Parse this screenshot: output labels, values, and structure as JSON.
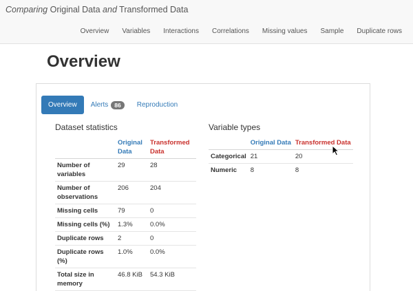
{
  "header": {
    "title_part1": "Comparing",
    "title_part2": " Original Data ",
    "title_part3": "and",
    "title_part4": " Transformed Data",
    "nav": [
      "Overview",
      "Variables",
      "Interactions",
      "Correlations",
      "Missing values",
      "Sample",
      "Duplicate rows"
    ]
  },
  "page_title": "Overview",
  "tabs": {
    "overview": "Overview",
    "alerts": "Alerts",
    "alerts_count": "86",
    "reproduction": "Reproduction"
  },
  "dataset_statistics": {
    "title": "Dataset statistics",
    "col_original": "Original Data",
    "col_transformed": "Transformed Data",
    "rows": [
      {
        "label": "Number of variables",
        "original": "29",
        "transformed": "28"
      },
      {
        "label": "Number of observations",
        "original": "206",
        "transformed": "204"
      },
      {
        "label": "Missing cells",
        "original": "79",
        "transformed": "0"
      },
      {
        "label": "Missing cells (%)",
        "original": "1.3%",
        "transformed": "0.0%"
      },
      {
        "label": "Duplicate rows",
        "original": "2",
        "transformed": "0"
      },
      {
        "label": "Duplicate rows (%)",
        "original": "1.0%",
        "transformed": "0.0%"
      },
      {
        "label": "Total size in memory",
        "original": "46.8 KiB",
        "transformed": "54.3 KiB"
      }
    ]
  },
  "variable_types": {
    "title": "Variable types",
    "col_original": "Original Data",
    "col_transformed": "Transformed Data",
    "rows": [
      {
        "label": "Categorical",
        "original": "21",
        "transformed": "20"
      },
      {
        "label": "Numeric",
        "original": "8",
        "transformed": "8"
      }
    ]
  },
  "colors": {
    "accent": "#337ab7",
    "transformed": "#c9302c",
    "badge": "#777777"
  }
}
